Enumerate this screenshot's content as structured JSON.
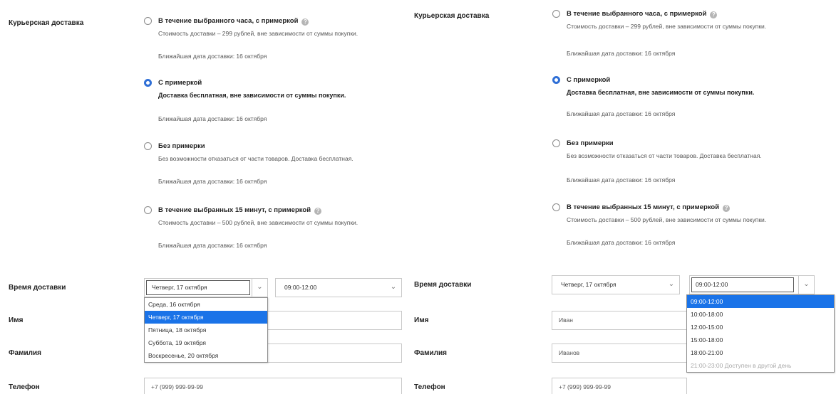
{
  "left": {
    "section_label": "Курьерская доставка",
    "options": [
      {
        "title": "В течение выбранного часа, с примеркой",
        "has_info": true,
        "checked": false,
        "desc": "Стоимость доставки – 299 рублей, вне зависимости от суммы покупки.",
        "date": "Ближайшая дата доставки: 16 октября"
      },
      {
        "title": "С примеркой",
        "has_info": false,
        "checked": true,
        "desc": "Доставка бесплатная, вне зависимости от суммы покупки.",
        "date": "Ближайшая дата доставки: 16 октября"
      },
      {
        "title": "Без примерки",
        "has_info": false,
        "checked": false,
        "desc": "Без возможности отказаться от части товаров. Доставка бесплатная.",
        "date": "Ближайшая дата доставки: 16 октября"
      },
      {
        "title": "В течение выбранных 15 минут, с примеркой",
        "has_info": true,
        "checked": false,
        "desc": "Стоимость доставки – 500 рублей, вне зависимости от суммы покупки.",
        "date": "Ближайшая дата доставки: 16 октября"
      }
    ],
    "delivery_time_label": "Время доставки",
    "date_select_value": "Четверг, 17 октября",
    "time_select_value": "09:00-12:00",
    "name_label": "Имя",
    "surname_label": "Фамилия",
    "phone_label": "Телефон",
    "phone_value": "+7 (999) 999-99-99",
    "date_dropdown": [
      {
        "label": "Среда, 16 октября",
        "selected": false
      },
      {
        "label": "Четверг, 17 октября",
        "selected": true
      },
      {
        "label": "Пятница, 18 октября",
        "selected": false
      },
      {
        "label": "Суббота, 19 октября",
        "selected": false
      },
      {
        "label": "Воскресенье, 20 октября",
        "selected": false
      }
    ]
  },
  "right": {
    "section_label": "Курьерская доставка",
    "options": [
      {
        "title": "В течение выбранного часа, с примеркой",
        "has_info": true,
        "checked": false,
        "desc": "Стоимость доставки – 299 рублей, вне зависимости от суммы покупки.",
        "date": "Ближайшая дата доставки: 16 октября"
      },
      {
        "title": "С примеркой",
        "has_info": false,
        "checked": true,
        "desc": "Доставка бесплатная, вне зависимости от суммы покупки.",
        "date": "Ближайшая дата доставки: 16 октября"
      },
      {
        "title": "Без примерки",
        "has_info": false,
        "checked": false,
        "desc": "Без возможности отказаться от части товаров. Доставка бесплатная.",
        "date": "Ближайшая дата доставки: 16 октября"
      },
      {
        "title": "В течение выбранных 15 минут, с примеркой",
        "has_info": true,
        "checked": false,
        "desc": "Стоимость доставки – 500 рублей, вне зависимости от суммы покупки.",
        "date": "Ближайшая дата доставки: 16 октября"
      }
    ],
    "delivery_time_label": "Время доставки",
    "date_select_value": "Четверг, 17 октября",
    "time_select_value": "09:00-12:00",
    "name_label": "Имя",
    "name_value": "Иван",
    "surname_label": "Фамилия",
    "surname_value": "Иванов",
    "phone_label": "Телефон",
    "phone_value": "+7 (999) 999-99-99",
    "time_dropdown": [
      {
        "label": "09:00-12:00",
        "selected": true,
        "disabled": false
      },
      {
        "label": "10:00-18:00",
        "selected": false,
        "disabled": false
      },
      {
        "label": "12:00-15:00",
        "selected": false,
        "disabled": false
      },
      {
        "label": "15:00-18:00",
        "selected": false,
        "disabled": false
      },
      {
        "label": "18:00-21:00",
        "selected": false,
        "disabled": false
      },
      {
        "label": "21:00-23:00 Доступен в другой день",
        "selected": false,
        "disabled": true
      }
    ]
  },
  "colors": {
    "accent": "#1a73e8",
    "radio_checked": "#2f6fd6"
  },
  "icons": {
    "info": "info-circle-icon",
    "chevron": "chevron-down-icon"
  }
}
